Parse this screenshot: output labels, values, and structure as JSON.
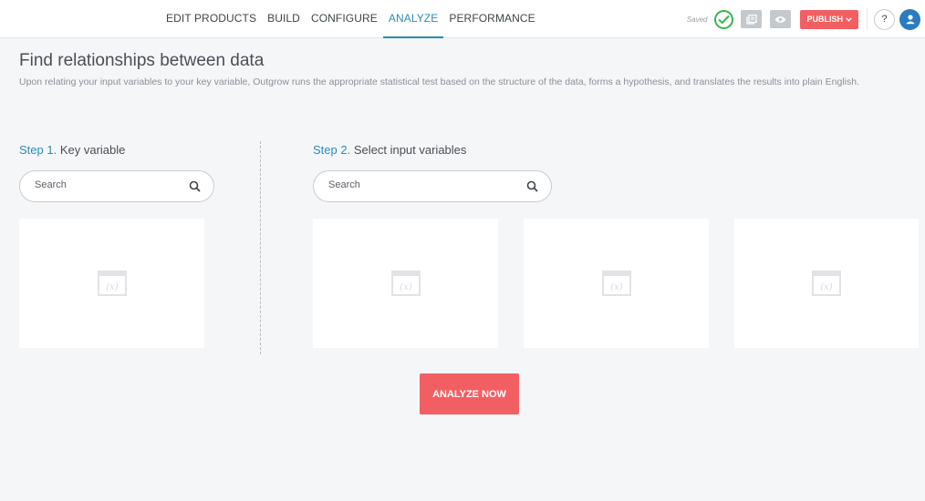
{
  "nav": {
    "items": [
      "EDIT PRODUCTS",
      "BUILD",
      "CONFIGURE",
      "ANALYZE",
      "PERFORMANCE"
    ],
    "active": "ANALYZE"
  },
  "toolbar": {
    "saved_label": "Saved",
    "publish_label": "PUBLISH",
    "help_label": "?"
  },
  "header": {
    "title": "Find relationships between data",
    "description": "Upon relating your input variables to your key variable, Outgrow runs the appropriate statistical test based on the structure of the data, forms a hypothesis, and translates the results into plain English."
  },
  "step1": {
    "number": "Step 1.",
    "label": "Key variable",
    "search_placeholder": "Search"
  },
  "step2": {
    "number": "Step 2.",
    "label": "Select input variables",
    "search_placeholder": "Search"
  },
  "variable_icon_text": "(x)",
  "analyze_label": "ANALYZE NOW",
  "colors": {
    "accent": "#2b8bb6",
    "primary_button": "#f25f63",
    "saved_check": "#39b54a",
    "avatar": "#2b7bbf"
  }
}
